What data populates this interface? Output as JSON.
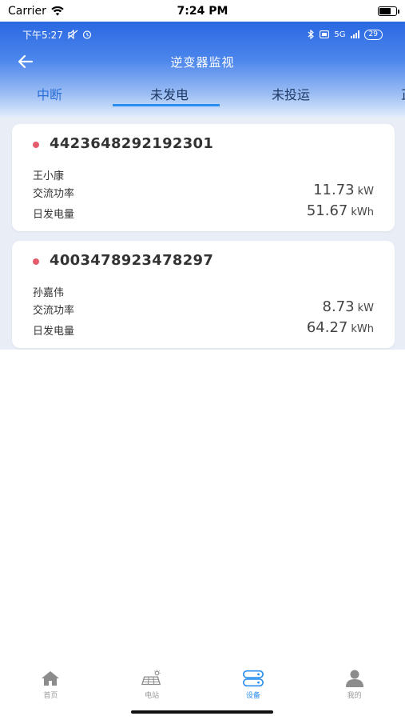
{
  "ios_status": {
    "carrier": "Carrier",
    "time": "7:24 PM"
  },
  "android_status": {
    "time": "下午5:27",
    "net": "5G",
    "battery": "29"
  },
  "nav": {
    "title": "逆变器监视"
  },
  "tabs": [
    {
      "label": "中断"
    },
    {
      "label": "未发电"
    },
    {
      "label": "未投运"
    },
    {
      "label": "正"
    }
  ],
  "devices": [
    {
      "serial": "4423648292192301",
      "owner": "王小康",
      "ac_power_label": "交流功率",
      "ac_power_value": "11.73",
      "ac_power_unit": "kW",
      "daily_energy_label": "日发电量",
      "daily_energy_value": "51.67",
      "daily_energy_unit": "kWh"
    },
    {
      "serial": "4003478923478297",
      "owner": "孙嘉伟",
      "ac_power_label": "交流功率",
      "ac_power_value": "8.73",
      "ac_power_unit": "kW",
      "daily_energy_label": "日发电量",
      "daily_energy_value": "64.27",
      "daily_energy_unit": "kWh"
    }
  ],
  "bottom_nav": [
    {
      "label": "首页",
      "icon": "home-icon"
    },
    {
      "label": "电站",
      "icon": "solar-station-icon"
    },
    {
      "label": "设备",
      "icon": "device-icon"
    },
    {
      "label": "我的",
      "icon": "user-icon"
    }
  ],
  "colors": {
    "accent": "#2a8ff0",
    "status_dot": "#e65c6c",
    "header_top": "#2a68e2"
  }
}
